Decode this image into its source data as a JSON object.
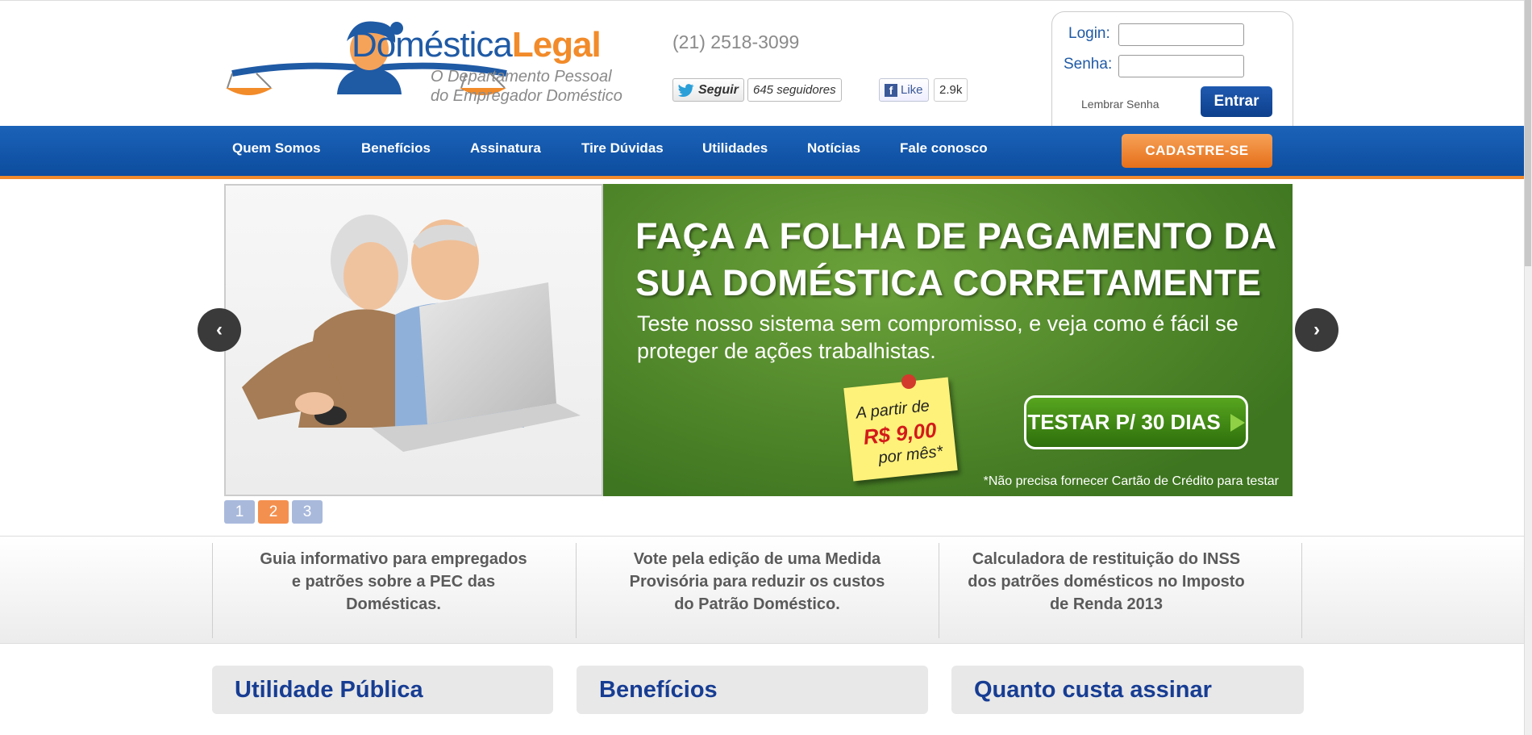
{
  "brand": {
    "name_part1": "Doméstica",
    "name_part2": "Legal",
    "tagline": "O Departamento Pessoal\ndo Empregador Doméstico"
  },
  "header": {
    "phone": "(21) 2518-3099",
    "twitter": {
      "label": "Seguir",
      "count": "645 seguidores"
    },
    "facebook": {
      "label": "Like",
      "count": "2.9k"
    }
  },
  "login": {
    "login_label": "Login:",
    "password_label": "Senha:",
    "login_value": "",
    "password_value": "",
    "remember_label": "Lembrar Senha",
    "submit_label": "Entrar"
  },
  "nav": {
    "items": [
      {
        "label": "Quem Somos"
      },
      {
        "label": "Benefícios"
      },
      {
        "label": "Assinatura"
      },
      {
        "label": "Tire Dúvidas"
      },
      {
        "label": "Utilidades"
      },
      {
        "label": "Notícias"
      },
      {
        "label": "Fale conosco"
      }
    ],
    "cta_label": "CADASTRE-SE"
  },
  "slider": {
    "headline": "FAÇA A FOLHA DE PAGAMENTO DA SUA DOMÉSTICA CORRETAMENTE",
    "subheadline": "Teste nosso sistema sem compromisso, e veja como é fácil se proteger de ações trabalhistas.",
    "price_prefix": "A partir de",
    "price": "R$ 9,00",
    "price_suffix": "por mês*",
    "cta_label": "TESTAR P/ 30 DIAS",
    "disclaimer": "*Não precisa fornecer Cartão de Crédito para testar",
    "prev_label": "‹",
    "next_label": "›",
    "pages": [
      "1",
      "2",
      "3"
    ],
    "active_page": 2,
    "colors": {
      "dot_inactive": "#a9b9dc",
      "dot_active": "#f4904f"
    }
  },
  "highlights": [
    {
      "text": "Guia informativo para empregados e patrões sobre a PEC das Domésticas."
    },
    {
      "text": "Vote pela edição de uma Medida Provisória para reduzir os custos do Patrão Doméstico."
    },
    {
      "text": "Calculadora de restituição do INSS dos patrões domésticos no Imposto de Renda 2013"
    }
  ],
  "sections": [
    {
      "title": "Utilidade Pública"
    },
    {
      "title": "Benefícios"
    },
    {
      "title": "Quanto custa assinar"
    }
  ],
  "colors": {
    "brand_blue": "#1f5aa5",
    "brand_orange": "#f28b2a",
    "nav_blue": "#0c4c9e",
    "banner_green": "#4e8a2a"
  }
}
